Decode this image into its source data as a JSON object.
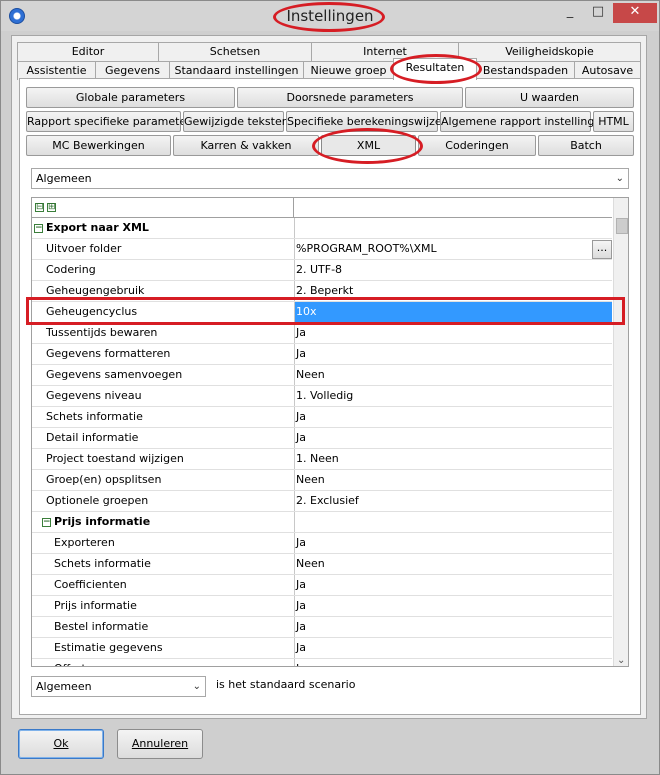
{
  "window": {
    "title": "Instellingen",
    "minimize": "_",
    "maximize": "□",
    "close": "✕"
  },
  "tabs": {
    "row1": [
      "Editor",
      "Schetsen",
      "Internet",
      "Veiligheidskopie"
    ],
    "row2": [
      "Assistentie",
      "Gegevens",
      "Standaard instellingen",
      "Nieuwe groep",
      "Resultaten",
      "Bestandspaden",
      "Autosave"
    ]
  },
  "sub_buttons": {
    "row1": [
      "Globale parameters",
      "Doorsnede parameters",
      "U waarden"
    ],
    "row2": [
      "Rapport specifieke parameters",
      "Gewijzigde teksten",
      "Specifieke berekeningswijzen",
      "Algemene rapport instellingen",
      "HTML"
    ],
    "row3": [
      "MC Bewerkingen",
      "Karren & vakken",
      "XML",
      "Coderingen",
      "Batch"
    ]
  },
  "top_combo": {
    "value": "Algemeen"
  },
  "grid": {
    "header_icons": [
      "⊟",
      "⊞"
    ],
    "rows": [
      {
        "name": "Export naar XML",
        "value": "",
        "type": "group"
      },
      {
        "name": "Uitvoer folder",
        "value": "%PROGRAM_ROOT%\\XML",
        "has_button": true
      },
      {
        "name": "Codering",
        "value": "2. UTF-8"
      },
      {
        "name": "Geheugengebruik",
        "value": "2. Beperkt"
      },
      {
        "name": "Geheugencyclus",
        "value": "10x",
        "selected": true
      },
      {
        "name": "Tussentijds bewaren",
        "value": "Ja"
      },
      {
        "name": "Gegevens formatteren",
        "value": "Ja"
      },
      {
        "name": "Gegevens samenvoegen",
        "value": "Neen"
      },
      {
        "name": "Gegevens niveau",
        "value": "1. Volledig"
      },
      {
        "name": "Schets informatie",
        "value": "Ja"
      },
      {
        "name": "Detail informatie",
        "value": "Ja"
      },
      {
        "name": "Project toestand wijzigen",
        "value": "1. Neen"
      },
      {
        "name": "Groep(en) opsplitsen",
        "value": "Neen"
      },
      {
        "name": "Optionele groepen",
        "value": "2. Exclusief"
      },
      {
        "name": "Prijs informatie",
        "value": "",
        "type": "subgroup"
      },
      {
        "name": "Exporteren",
        "value": "Ja",
        "indent": true
      },
      {
        "name": "Schets informatie",
        "value": "Neen",
        "indent": true
      },
      {
        "name": "Coefficienten",
        "value": "Ja",
        "indent": true
      },
      {
        "name": "Prijs informatie",
        "value": "Ja",
        "indent": true
      },
      {
        "name": "Bestel informatie",
        "value": "Ja",
        "indent": true
      },
      {
        "name": "Estimatie gegevens",
        "value": "Ja",
        "indent": true
      },
      {
        "name": "Offerte gegevens",
        "value": "Ja",
        "indent": true
      }
    ]
  },
  "footer": {
    "scenario_value": "Algemeen",
    "scenario_text": "is het standaard scenario"
  },
  "dialog_buttons": {
    "ok": "Ok",
    "cancel": "Annuleren"
  }
}
